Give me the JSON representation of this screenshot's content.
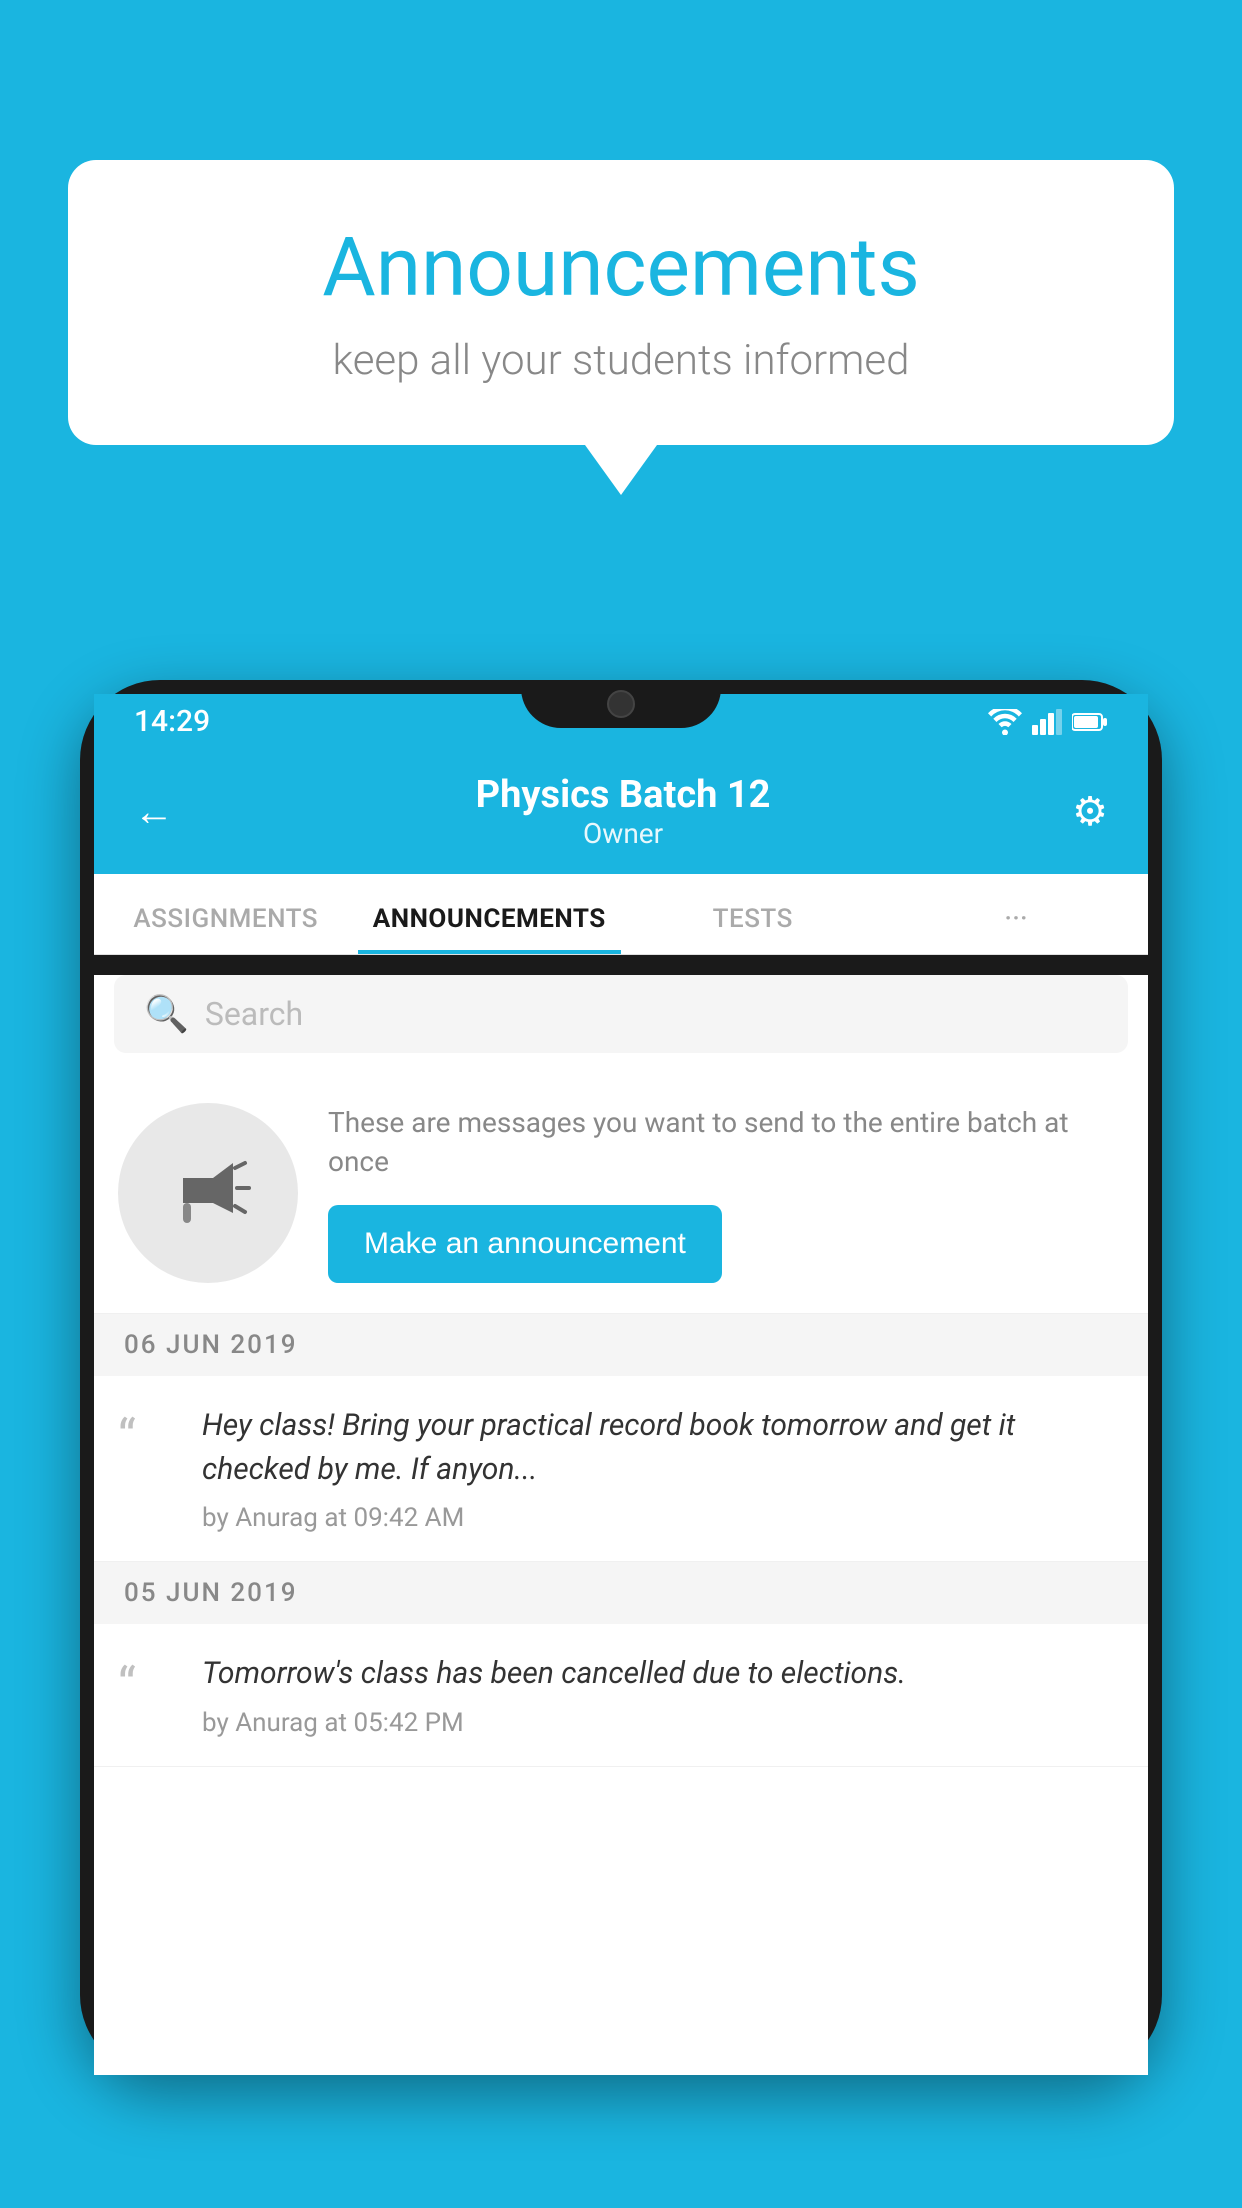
{
  "background_color": "#1ab5e0",
  "speech_bubble": {
    "title": "Announcements",
    "subtitle": "keep all your students informed"
  },
  "phone": {
    "status_bar": {
      "time": "14:29",
      "icons": [
        "wifi",
        "signal",
        "battery"
      ]
    },
    "header": {
      "title": "Physics Batch 12",
      "subtitle": "Owner",
      "back_label": "←",
      "gear_label": "⚙"
    },
    "tabs": [
      {
        "label": "ASSIGNMENTS",
        "active": false
      },
      {
        "label": "ANNOUNCEMENTS",
        "active": true
      },
      {
        "label": "TESTS",
        "active": false
      },
      {
        "label": "···",
        "active": false
      }
    ],
    "search": {
      "placeholder": "Search"
    },
    "empty_state": {
      "description": "These are messages you want to send to the entire batch at once",
      "button_label": "Make an announcement"
    },
    "announcements": [
      {
        "date": "06  JUN  2019",
        "text": "Hey class! Bring your practical record book tomorrow and get it checked by me. If anyon...",
        "author": "by Anurag at 09:42 AM"
      },
      {
        "date": "05  JUN  2019",
        "text": "Tomorrow's class has been cancelled due to elections.",
        "author": "by Anurag at 05:42 PM"
      }
    ]
  }
}
